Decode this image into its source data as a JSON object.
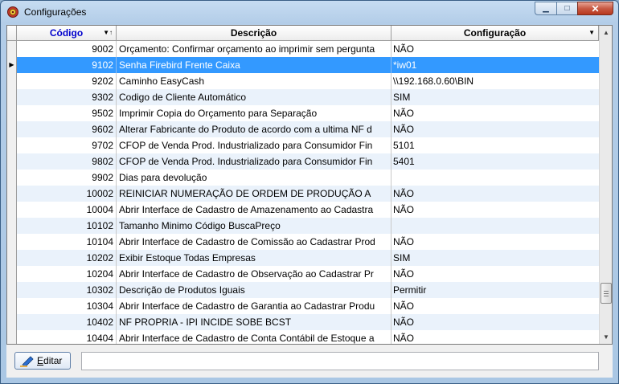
{
  "window": {
    "title": "Configurações",
    "min_glyph": "▁",
    "max_glyph": "□",
    "close_glyph": "✕"
  },
  "grid": {
    "columns": [
      {
        "label": "Código",
        "color": "#0000cc",
        "sort_glyph": "▼↑"
      },
      {
        "label": "Descrição"
      },
      {
        "label": "Configuração",
        "dropdown_glyph": "▼"
      }
    ],
    "current_row_glyph": "▶",
    "rows": [
      {
        "codigo": "9002",
        "descricao": "Orçamento: Confirmar orçamento ao imprimir sem pergunta",
        "config": "NÃO"
      },
      {
        "codigo": "9102",
        "descricao": "Senha Firebird Frente Caixa",
        "config": "*iw01"
      },
      {
        "codigo": "9202",
        "descricao": "Caminho EasyCash",
        "config": "\\\\192.168.0.60\\BIN"
      },
      {
        "codigo": "9302",
        "descricao": "Codigo de Cliente Automático",
        "config": "SIM"
      },
      {
        "codigo": "9502",
        "descricao": "Imprimir Copia do Orçamento para Separação",
        "config": "NÃO"
      },
      {
        "codigo": "9602",
        "descricao": "Alterar Fabricante do Produto de acordo com a ultima NF d",
        "config": "NÃO"
      },
      {
        "codigo": "9702",
        "descricao": "CFOP de Venda Prod. Industrializado para Consumidor Fin",
        "config": "5101"
      },
      {
        "codigo": "9802",
        "descricao": "CFOP de Venda Prod. Industrializado para Consumidor Fin",
        "config": "5401"
      },
      {
        "codigo": "9902",
        "descricao": "Dias para devolução",
        "config": ""
      },
      {
        "codigo": "10002",
        "descricao": "REINICIAR NUMERAÇÃO DE ORDEM DE PRODUÇÃO A",
        "config": "NÃO"
      },
      {
        "codigo": "10004",
        "descricao": "Abrir Interface de Cadastro de Amazenamento ao Cadastra",
        "config": "NÃO"
      },
      {
        "codigo": "10102",
        "descricao": "Tamanho Minimo Código BuscaPreço",
        "config": ""
      },
      {
        "codigo": "10104",
        "descricao": "Abrir Interface de Cadastro de Comissão ao Cadastrar Prod",
        "config": "NÃO"
      },
      {
        "codigo": "10202",
        "descricao": "Exibir Estoque Todas Empresas",
        "config": "SIM"
      },
      {
        "codigo": "10204",
        "descricao": "Abrir Interface de Cadastro de Observação ao Cadastrar Pr",
        "config": "NÃO"
      },
      {
        "codigo": "10302",
        "descricao": "Descrição de Produtos Iguais",
        "config": "Permitir"
      },
      {
        "codigo": "10304",
        "descricao": "Abrir Interface de Cadastro de Garantia ao Cadastrar Produ",
        "config": "NÃO"
      },
      {
        "codigo": "10402",
        "descricao": "NF PROPRIA - IPI INCIDE SOBE BCST",
        "config": "NÃO"
      },
      {
        "codigo": "10404",
        "descricao": "Abrir Interface de Cadastro de Conta Contábil de Estoque a",
        "config": "NÃO"
      }
    ],
    "selected_index": 1,
    "scroll_up_glyph": "▲",
    "scroll_down_glyph": "▼"
  },
  "footer": {
    "edit_button_accel": "E",
    "edit_button_rest": "ditar",
    "edit_input_value": ""
  }
}
